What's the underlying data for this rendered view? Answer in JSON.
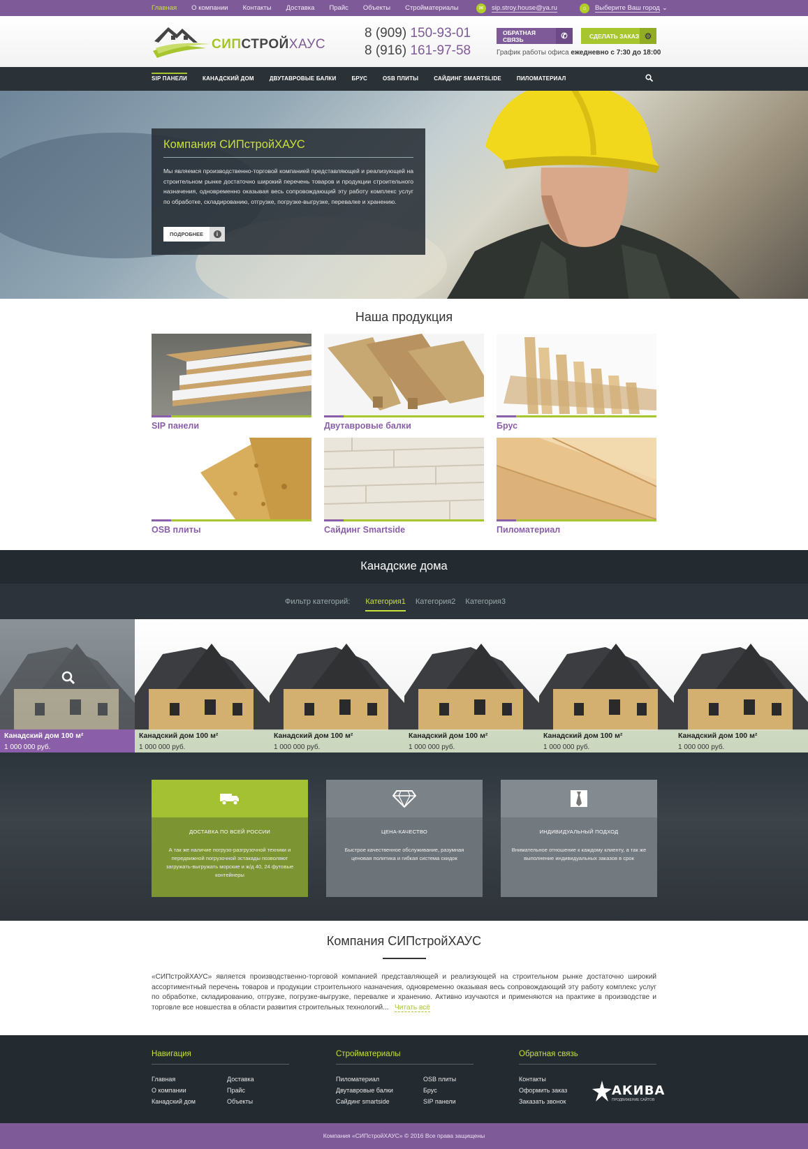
{
  "topbar": {
    "nav": [
      "Главная",
      "О компании",
      "Контакты",
      "Доставка",
      "Прайс",
      "Объекты",
      "Стройматериалы"
    ],
    "email": "sip.stroy.house@ya.ru",
    "city": "Выберите Ваш город"
  },
  "header": {
    "logo_part1": "СИП",
    "logo_part2": "СТРОЙ",
    "logo_part3": "ХАУС",
    "phone1_prefix": "8 (909) ",
    "phone1_num": "150-93-01",
    "phone2_prefix": "8 (916) ",
    "phone2_num": "161-97-58",
    "callback_btn": "ОБРАТНАЯ СВЯЗЬ",
    "order_btn": "СДЕЛАТЬ ЗАКАЗ",
    "schedule_label": "График работы офиса ",
    "schedule_value": "ежедневно с 7:30 до 18:00"
  },
  "mainnav": [
    "SIP ПАНЕЛИ",
    "КАНАДСКИЙ ДОМ",
    "ДВУТАВРОВЫЕ БАЛКИ",
    "БРУС",
    "OSB ПЛИТЫ",
    "САЙДИНГ SMARTSLIDE",
    "ПИЛОМАТЕРИАЛ"
  ],
  "hero": {
    "title": "Компания СИПстройХАУС",
    "text": "Мы являемся производственно-торговой компанией представляющей и реализующей на строительном рынке достаточно широкий перечень товаров и продукции строительного назначения, одновременно оказывая весь сопровождающий эту работу комплекс услуг по обработке, складированию, отгрузке, погрузке-выгрузке, перевалке и хранению.",
    "btn": "ПОДРОБНЕЕ"
  },
  "products": {
    "title": "Наша продукция",
    "items": [
      "SIP панели",
      "Двутавровые балки",
      "Брус",
      "OSB плиты",
      "Сайдинг Smartside",
      "Пиломатериал"
    ]
  },
  "canadian": {
    "title": "Канадские дома",
    "filter_label": "Фильтр категорий:",
    "filters": [
      "Категория1",
      "Категория2",
      "Категория3"
    ],
    "houses": [
      {
        "name": "Канадский дом 100 м²",
        "price": "1 000 000 руб."
      },
      {
        "name": "Канадский дом 100 м²",
        "price": "1 000 000 руб."
      },
      {
        "name": "Канадский дом 100 м²",
        "price": "1 000 000 руб."
      },
      {
        "name": "Канадский дом 100 м²",
        "price": "1 000 000 руб."
      },
      {
        "name": "Канадский дом 100 м²",
        "price": "1 000 000 руб."
      },
      {
        "name": "Канадский дом 100 м²",
        "price": "1 000 000 руб."
      }
    ]
  },
  "features": [
    {
      "title": "ДОСТАВКА ПО ВСЕЙ РОССИИ",
      "text": "А так же наличие погрузо-разгрузочной техники и передвижной погрузочной эстакады позволяют загружать-выгружать морские и ж/д 40, 24 футовые контейнеры"
    },
    {
      "title": "ЦЕНА-КАЧЕСТВО",
      "text": "Быстрое качественное обслуживание, разумная ценовая политика и гибкая система скидок"
    },
    {
      "title": "ИНДИВИДУАЛЬНЫЙ ПОДХОД",
      "text": "Внимательное отношение к каждому клиенту, а так же выполнение индивидуальных заказов в срок"
    }
  ],
  "about": {
    "title": "Компания СИПстройХАУС",
    "text": "«СИПстройХАУС» является производственно-торговой компанией представляющей и реализующей на строительном рынке достаточно широкий ассортиментный перечень товаров и продукции строительного назначения, одновременно оказывая весь сопровождающий эту работу комплекс услуг по обработке, складированию, отгрузке, погрузке-выгрузке, перевалке и хранению. Активно изучаются и применяются на практике в производстве и торговле все новшества в области развития строительных технологий...",
    "more": "Читать всё"
  },
  "footer": {
    "nav_title": "Навигация",
    "nav_col1": [
      "Главная",
      "О компании",
      "Канадский дом"
    ],
    "nav_col2": [
      "Доставка",
      "Прайс",
      "Объекты"
    ],
    "mat_title": "Стройматериалы",
    "mat_col1": [
      "Пиломатериал",
      "Двутавровые балки",
      "Сайдинг smartside"
    ],
    "mat_col2": [
      "OSB плиты",
      "Брус",
      "SIP панели"
    ],
    "fb_title": "Обратная связь",
    "fb_col": [
      "Контакты",
      "Оформить заказ",
      "Заказать звонок"
    ],
    "akiva": "АКИВА",
    "akiva_sub": "ПРОДВИЖЕНИЕ САЙТОВ",
    "copyright": "Компания «СИПстройХАУС» © 2016 Все права защищены"
  }
}
